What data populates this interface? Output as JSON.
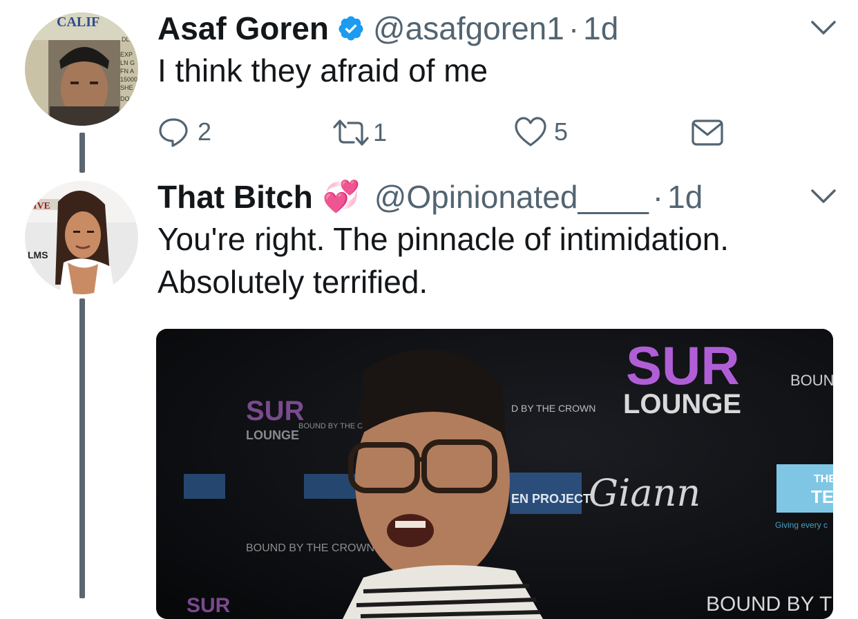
{
  "thread": {
    "tweets": [
      {
        "author": "Asaf Goren",
        "verified": true,
        "handle": "@asafgoren1",
        "separator": "·",
        "time": "1d",
        "text": "I think they afraid of me",
        "actions": {
          "reply_count": "2",
          "retweet_count": "1",
          "like_count": "5"
        },
        "avatar_text": {
          "state": "CALIF",
          "exp": "EXP",
          "ln": "LN G",
          "fn": "FN A",
          "num": "15000",
          "she": "SHE",
          "do": "DO",
          "dl": "DL"
        }
      },
      {
        "author": "That Bitch",
        "emoji": "💞",
        "handle": "@Opinionated____",
        "separator": "·",
        "time": "1d",
        "text_line1": "You're right. The pinnacle of intimidation.",
        "text_line2": "Absolutely terrified.",
        "avatar_text": {
          "top": "IVE",
          "side": "LMS"
        },
        "media_text": {
          "sur_big": "SUR",
          "lounge_big": "LOUNGE",
          "sur_small": "SUR",
          "lounge_small": "LOUNGE",
          "bound_top": "BOUND",
          "by_the_crown": "D BY THE CROWN",
          "bound_by_the_small": "BOUND BY THE C",
          "bound_bottom_left": "BOUND BY THE CROWN",
          "ten_project": "EN PROJECT",
          "signature": "Giann",
          "the_label": "THE",
          "te_label": "TE",
          "giving": "Giving every c",
          "bound_bottom_right": "BOUND BY TH",
          "sur_bottom": "SUR"
        }
      }
    ]
  },
  "colors": {
    "verified_badge": "#1d9bf0",
    "action_gray": "#536471",
    "thread_line": "#5b6670",
    "sur_purple": "#b05ed6"
  },
  "icons": {
    "reply": "speech-bubble-icon",
    "retweet": "retweet-icon",
    "like": "heart-outline-icon",
    "dm": "envelope-icon",
    "menu": "chevron-down-icon",
    "verified": "verified-badge-icon"
  }
}
